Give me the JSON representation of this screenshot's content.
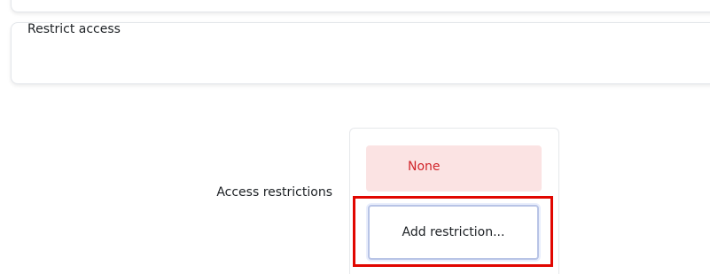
{
  "section": {
    "title": "Restrict access"
  },
  "access_restrictions": {
    "label": "Access restrictions",
    "status_text": "None",
    "add_button_label": "Add restriction..."
  },
  "colors": {
    "none_text": "#d1252b",
    "none_background": "#fbe3e3",
    "highlight_border": "#e10600",
    "button_border": "#b8c4e6"
  }
}
